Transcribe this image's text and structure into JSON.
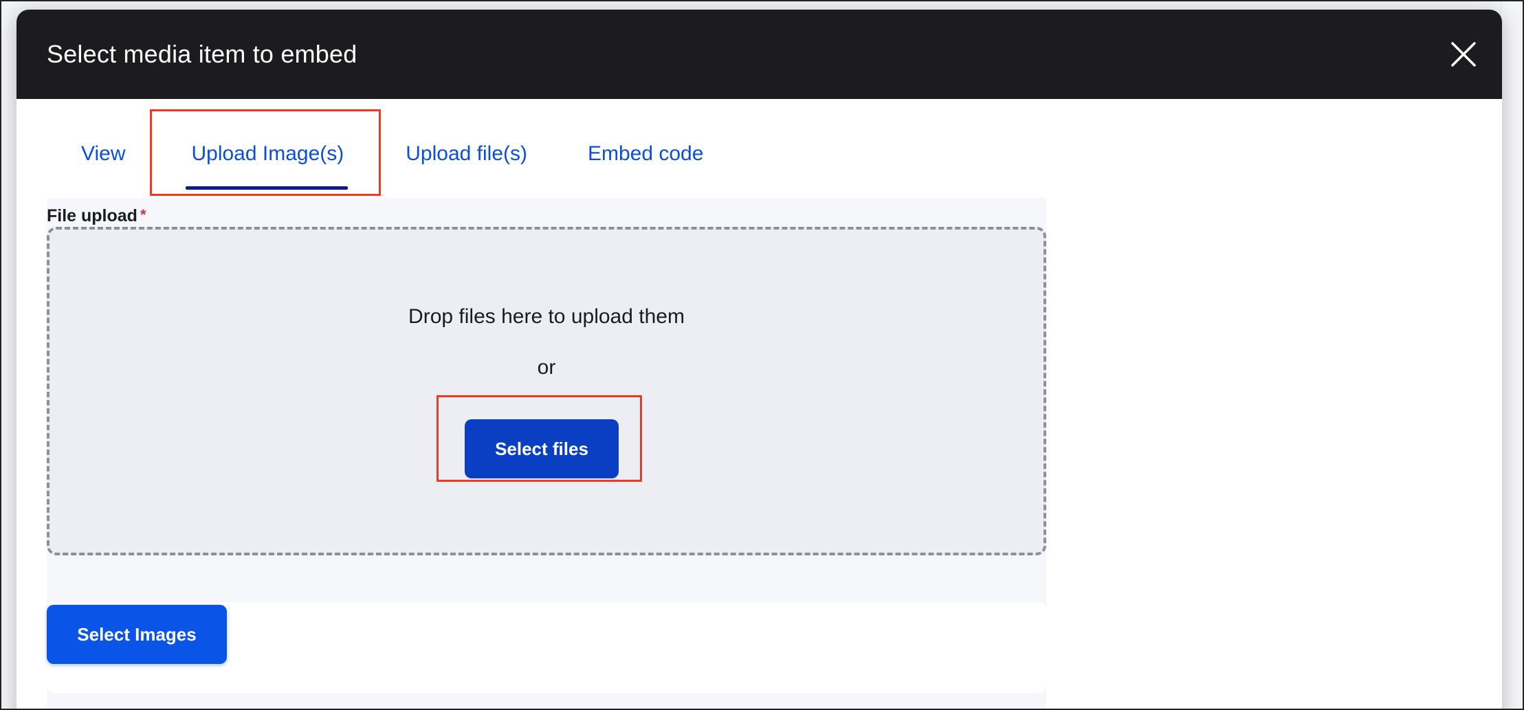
{
  "modal": {
    "title": "Select media item to embed"
  },
  "tabs": [
    {
      "label": "View",
      "active": false
    },
    {
      "label": "Upload Image(s)",
      "active": true
    },
    {
      "label": "Upload file(s)",
      "active": false
    },
    {
      "label": "Embed code",
      "active": false
    }
  ],
  "upload": {
    "label": "File upload",
    "required_marker": "*",
    "drop_text": "Drop files here to upload them",
    "or_text": "or",
    "select_files_label": "Select files"
  },
  "actions": {
    "select_images_label": "Select Images"
  },
  "colors": {
    "header_bg": "#1c1c1e",
    "tab_link": "#0a4fd6",
    "tab_underline": "#0b1a8c",
    "primary_button": "#0a55e8",
    "highlight_box": "#ee3a22"
  }
}
